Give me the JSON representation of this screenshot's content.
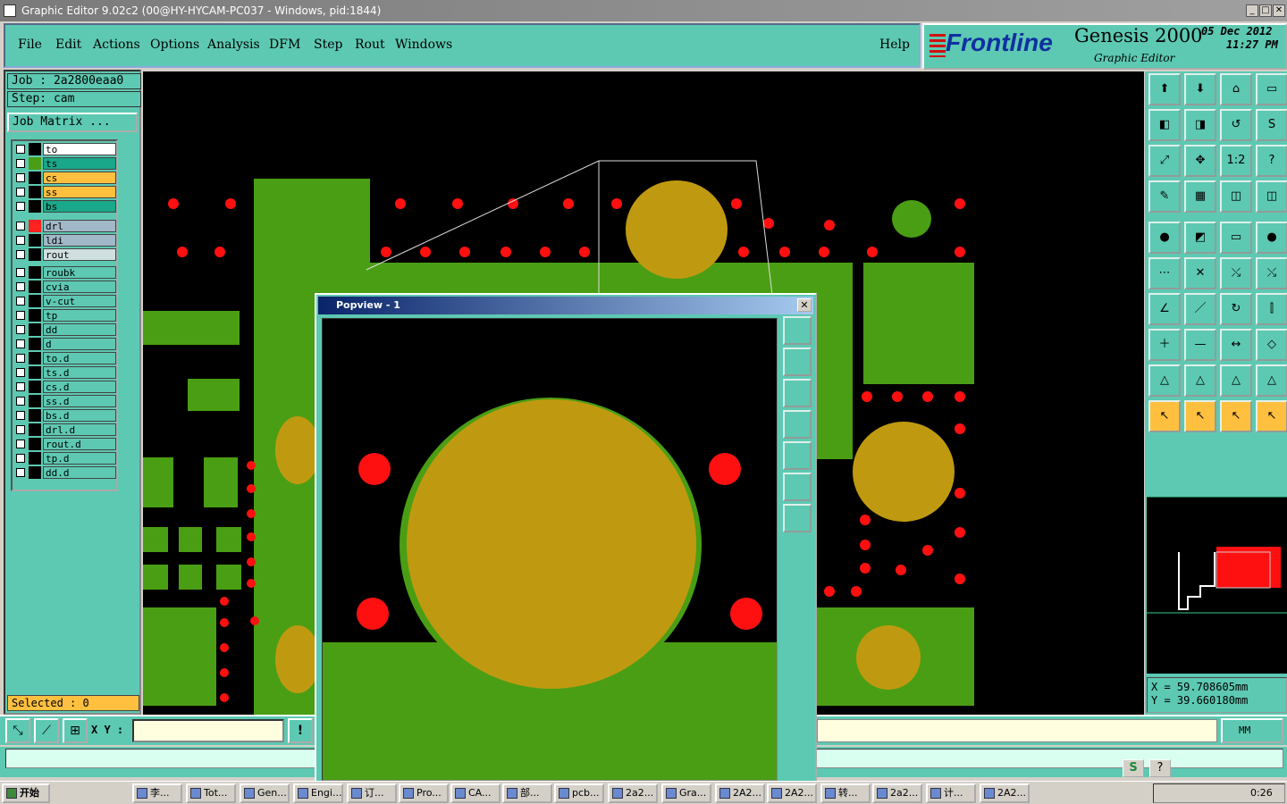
{
  "window": {
    "title": "Graphic Editor 9.02c2 (00@HY-HYCAM-PC037 - Windows, pid:1844)",
    "min": "_",
    "max": "□",
    "close": "✕"
  },
  "menu": {
    "file": "File",
    "edit": "Edit",
    "actions": "Actions",
    "options": "Options",
    "analysis": "Analysis",
    "dfm": "DFM",
    "step": "Step",
    "rout": "Rout",
    "windows": "Windows",
    "help": "Help"
  },
  "brand": {
    "logo": "Frontline",
    "product": "Genesis 2000",
    "subtitle": "Graphic Editor",
    "date": "05 Dec 2012",
    "time": "11:27 PM"
  },
  "job": {
    "job_label": "Job : 2a2800eaa0",
    "step_label": "Step: cam",
    "matrix_button": "Job Matrix ..."
  },
  "layers": [
    {
      "name": "to",
      "bg": "#ffffff",
      "swatch": "#000000"
    },
    {
      "name": "ts",
      "bg": "#19a889",
      "swatch": "#4a9e14"
    },
    {
      "name": "cs",
      "bg": "#ffc040",
      "swatch": "#000000"
    },
    {
      "name": "ss",
      "bg": "#ffc040",
      "swatch": "#000000"
    },
    {
      "name": "bs",
      "bg": "#19a889",
      "swatch": "#000000"
    },
    {
      "name": "drl",
      "bg": "#a0b8c8",
      "swatch": "#ff2020"
    },
    {
      "name": "ldi",
      "bg": "#a0b8c8",
      "swatch": "#000000"
    },
    {
      "name": "rout",
      "bg": "#d0e0e0",
      "swatch": "#000000"
    },
    {
      "name": "roubk",
      "bg": "#5dc9b2",
      "swatch": "#000000"
    },
    {
      "name": "cvia",
      "bg": "#5dc9b2",
      "swatch": "#000000"
    },
    {
      "name": "v-cut",
      "bg": "#5dc9b2",
      "swatch": "#000000"
    },
    {
      "name": "tp",
      "bg": "#5dc9b2",
      "swatch": "#000000"
    },
    {
      "name": "dd",
      "bg": "#5dc9b2",
      "swatch": "#000000"
    },
    {
      "name": "d",
      "bg": "#5dc9b2",
      "swatch": "#000000"
    },
    {
      "name": "to.d",
      "bg": "#5dc9b2",
      "swatch": "#000000"
    },
    {
      "name": "ts.d",
      "bg": "#5dc9b2",
      "swatch": "#000000"
    },
    {
      "name": "cs.d",
      "bg": "#5dc9b2",
      "swatch": "#000000"
    },
    {
      "name": "ss.d",
      "bg": "#5dc9b2",
      "swatch": "#000000"
    },
    {
      "name": "bs.d",
      "bg": "#5dc9b2",
      "swatch": "#000000"
    },
    {
      "name": "drl.d",
      "bg": "#5dc9b2",
      "swatch": "#000000"
    },
    {
      "name": "rout.d",
      "bg": "#5dc9b2",
      "swatch": "#000000"
    },
    {
      "name": "tp.d",
      "bg": "#5dc9b2",
      "swatch": "#000000"
    },
    {
      "name": "dd.d",
      "bg": "#5dc9b2",
      "swatch": "#000000"
    }
  ],
  "selected": "Selected : 0",
  "xy_label": "X Y :",
  "xy_value": "",
  "units": "MM",
  "coords": {
    "x": "X  =  59.708605mm",
    "y": "Y  =  39.660180mm"
  },
  "popview": {
    "title": "Popview - 1"
  },
  "colors": {
    "copper": "#4a9e14",
    "pad": "#bf9a10",
    "drill": "#ff1010",
    "panel": "#5dc9b2"
  },
  "taskbar": {
    "start": "开始",
    "clock": "0:26",
    "tasks": [
      "李...",
      "Tot...",
      "Gen...",
      "Engi...",
      "订...",
      "Pro...",
      "CA...",
      "部...",
      "pcb...",
      "2a2...",
      "Gra...",
      "2A2...",
      "2A2...",
      "转...",
      "2a2...",
      "计...",
      "2A2..."
    ]
  }
}
